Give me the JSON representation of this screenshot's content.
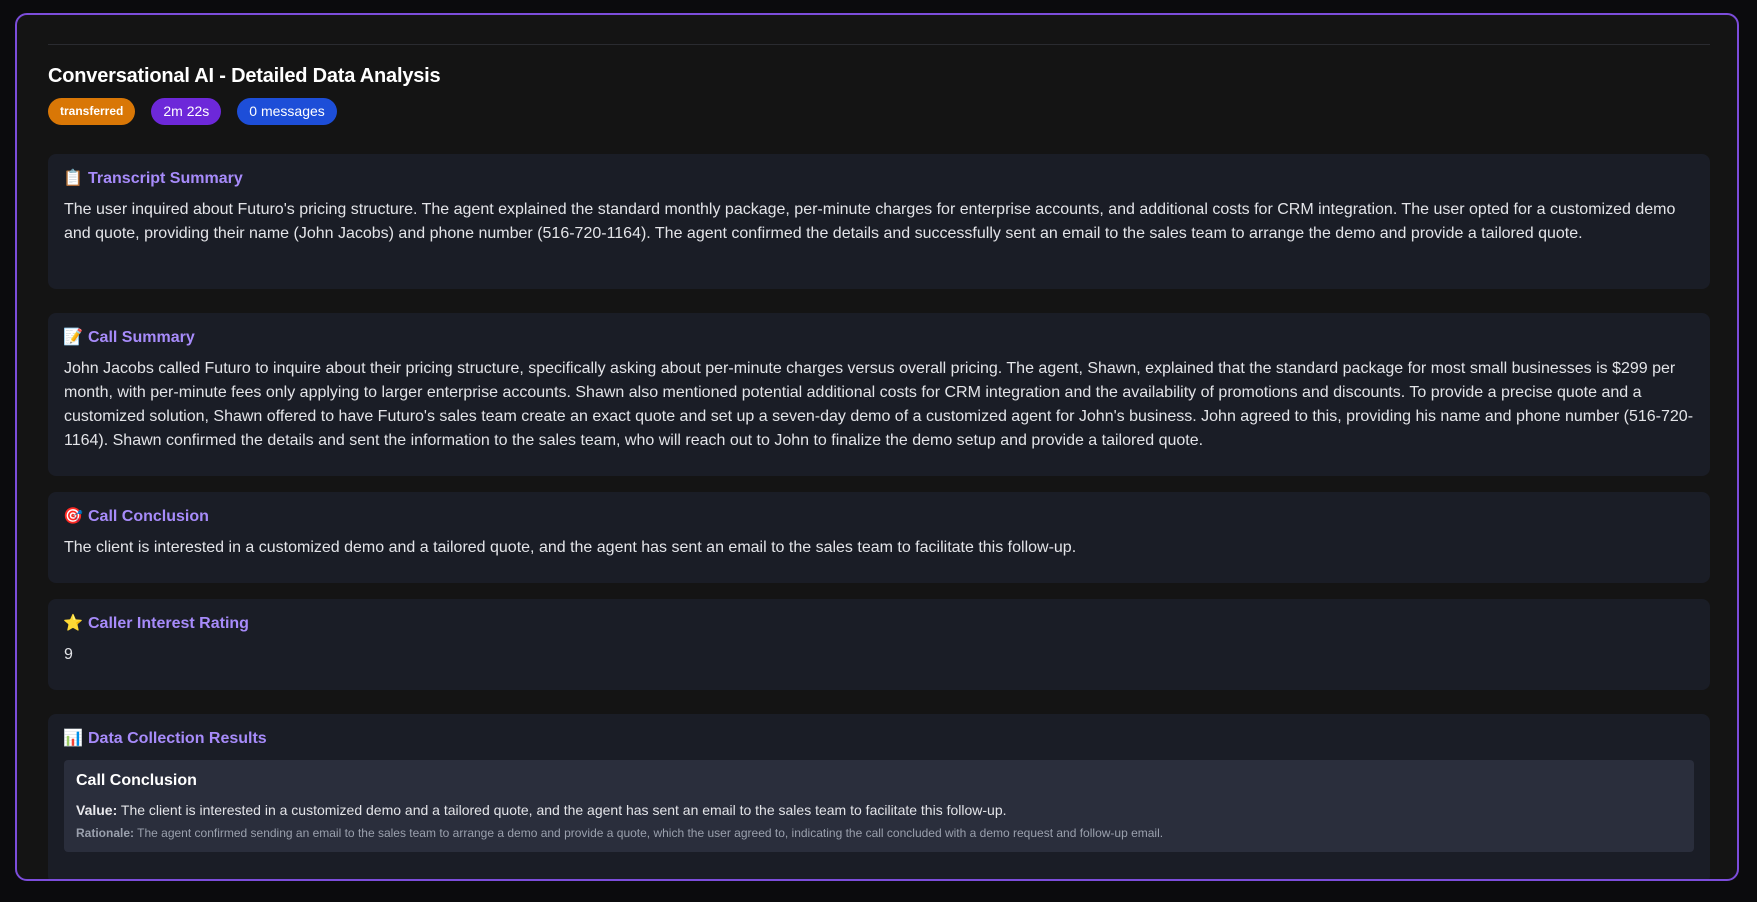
{
  "modal": {
    "title": "Conversational AI - Detailed Data Analysis",
    "badges": {
      "status": "transferred",
      "duration": "2m 22s",
      "messages": "0 messages"
    }
  },
  "sections": {
    "transcript_summary": {
      "icon": "clipboard-icon",
      "icon_glyph": "📋",
      "title": "Transcript Summary",
      "body": "The user inquired about Futuro's pricing structure. The agent explained the standard monthly package, per-minute charges for enterprise accounts, and additional costs for CRM integration. The user opted for a customized demo and quote, providing their name (John Jacobs) and phone number (516-720-1164). The agent confirmed the details and successfully sent an email to the sales team to arrange the demo and provide a tailored quote."
    },
    "call_summary": {
      "icon": "memo-icon",
      "icon_glyph": "📝",
      "title": "Call Summary",
      "body": "John Jacobs called Futuro to inquire about their pricing structure, specifically asking about per-minute charges versus overall pricing. The agent, Shawn, explained that the standard package for most small businesses is $299 per month, with per-minute fees only applying to larger enterprise accounts. Shawn also mentioned potential additional costs for CRM integration and the availability of promotions and discounts. To provide a precise quote and a customized solution, Shawn offered to have Futuro's sales team create an exact quote and set up a seven-day demo of a customized agent for John's business. John agreed to this, providing his name and phone number (516-720-1164). Shawn confirmed the details and sent the information to the sales team, who will reach out to John to finalize the demo setup and provide a tailored quote."
    },
    "call_conclusion": {
      "icon": "target-icon",
      "icon_glyph": "🎯",
      "title": "Call Conclusion",
      "body": "The client is interested in a customized demo and a tailored quote, and the agent has sent an email to the sales team to facilitate this follow-up."
    },
    "caller_interest": {
      "icon": "star-icon",
      "icon_glyph": "⭐",
      "title": "Caller Interest Rating",
      "body": "9"
    },
    "data_collection": {
      "icon": "bar-chart-icon",
      "icon_glyph": "📊",
      "title": "Data Collection Results",
      "items": [
        {
          "title": "Call Conclusion",
          "value_label": "Value:",
          "value": "The client is interested in a customized demo and a tailored quote, and the agent has sent an email to the sales team to facilitate this follow-up.",
          "rationale_label": "Rationale:",
          "rationale": "The agent confirmed sending an email to the sales team to arrange a demo and provide a quote, which the user agreed to, indicating the call concluded with a demo request and follow-up email."
        }
      ]
    }
  },
  "colors": {
    "accent_border": "#7c4ddb",
    "section_title": "#a78bfa",
    "status_badge": "#d97706",
    "duration_badge": "#6d28d9",
    "messages_badge": "#1d4ed8"
  }
}
